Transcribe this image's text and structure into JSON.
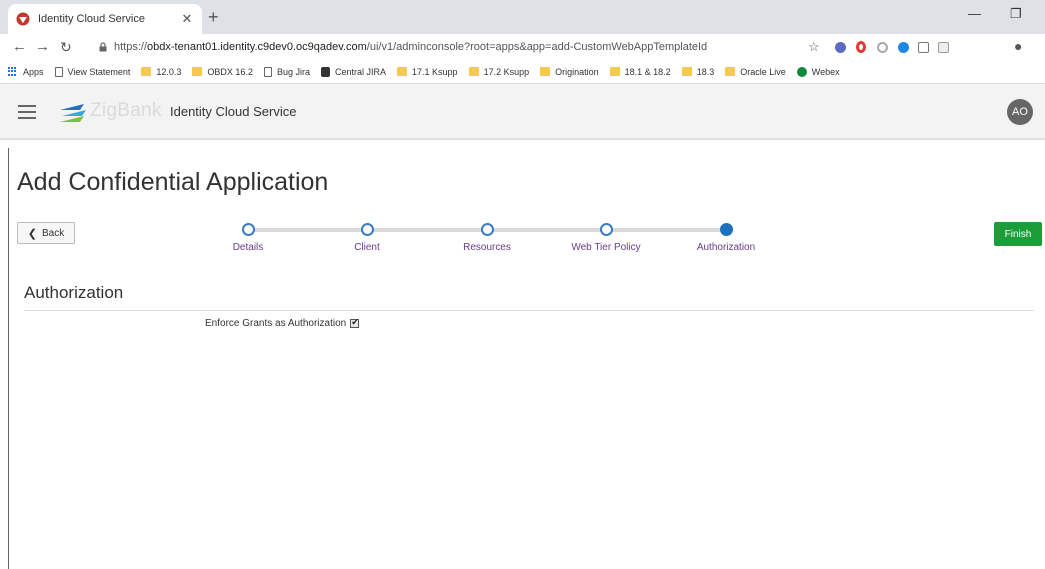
{
  "browser": {
    "tab_title": "Identity Cloud Service",
    "url_prefix": "https://",
    "url_host": "obdx-tenant01.identity.c9dev0.oc9qadev.com",
    "url_path": "/ui/v1/adminconsole?root=apps&app=add-CustomWebAppTemplateId",
    "bookmarks": [
      "Apps",
      "View Statement",
      "12.0.3",
      "OBDX 16.2",
      "Bug Jira",
      "Central JIRA",
      "17.1 Ksupp",
      "17.2 Ksupp",
      "Origination",
      "18.1 & 18.2",
      "18.3",
      "Oracle Live",
      "Webex"
    ]
  },
  "header": {
    "brand": "ZigBank",
    "service_title": "Identity Cloud Service",
    "avatar_initials": "AO"
  },
  "page": {
    "title": "Add Confidential Application",
    "back_label": "Back",
    "finish_label": "Finish"
  },
  "train": {
    "steps": [
      "Details",
      "Client",
      "Resources",
      "Web Tier Policy",
      "Authorization"
    ],
    "active_index": 4
  },
  "section": {
    "title": "Authorization",
    "enforce_grants_label": "Enforce Grants as Authorization",
    "enforce_grants_checked": true
  },
  "colors": {
    "finish": "#1b9e3a",
    "train_active": "#1f6fc0",
    "train_label": "#6b3a8c"
  }
}
